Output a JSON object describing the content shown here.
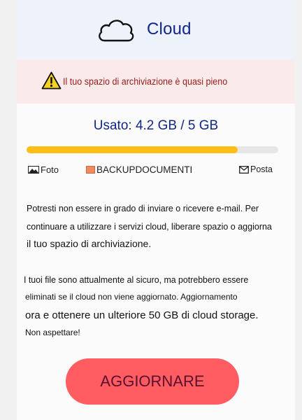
{
  "header": {
    "title": "Cloud",
    "icon": "cloud-icon"
  },
  "alert": {
    "icon": "warning-icon",
    "text": "Il tuo spazio di archiviazione è quasi pieno"
  },
  "storage": {
    "usage_label": "Usato: 4.2 GB / 5 GB",
    "used_fraction": 0.84,
    "fill_color": "#fbbd16",
    "legend": [
      {
        "icon": "photo-icon",
        "label": "Foto"
      },
      {
        "icon": "document-icon",
        "label": "BACKUPDOCUMENTI"
      },
      {
        "icon": "mail-icon",
        "label": "Posta"
      }
    ]
  },
  "message": {
    "paragraph1": [
      "Potresti non essere in grado di inviare o ricevere e-mail. Per",
      "continuare a utilizzare i servizi cloud, liberare spazio o aggiorna",
      "il tuo spazio di archiviazione."
    ],
    "paragraph2": [
      "I tuoi file sono attualmente al sicuro, ma potrebbero essere",
      "eliminati se il cloud non viene aggiornato. Aggiornamento",
      "ora e ottenere un ulteriore 50 GB di cloud storage.",
      "Non aspettare!"
    ]
  },
  "cta": {
    "label": "AGGIORNARE"
  }
}
